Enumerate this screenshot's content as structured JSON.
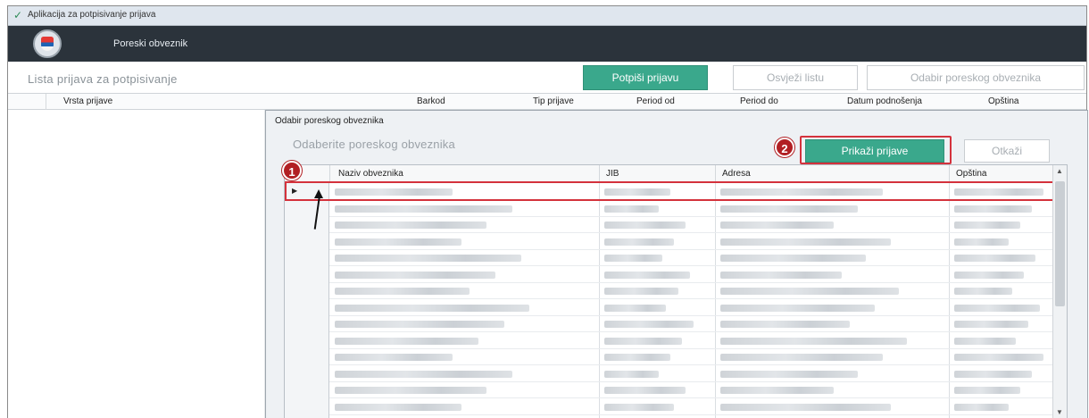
{
  "window": {
    "title": "Aplikacija za potpisivanje prijava"
  },
  "header": {
    "title": "Poreski obveznik"
  },
  "toolbar": {
    "list_title": "Lista prijava za potpisivanje",
    "sign_button": "Potpiši prijavu",
    "refresh_button": "Osvježi listu",
    "select_taxpayer_button": "Odabir poreskog obveznika"
  },
  "grid": {
    "columns": [
      "Vrsta prijave",
      "Barkod",
      "Tip prijave",
      "Period od",
      "Period do",
      "Datum podnošenja",
      "Opština"
    ]
  },
  "dialog": {
    "title": "Odabir poreskog obveznika",
    "subtitle": "Odaberite poreskog obveznika",
    "show_button": "Prikaži prijave",
    "cancel_button": "Otkaži",
    "columns": [
      "Naziv obveznika",
      "JIB",
      "Adresa",
      "Opština"
    ],
    "row_count": 14,
    "markers": [
      "1",
      "2"
    ]
  },
  "colors": {
    "accent": "#3aa88c",
    "highlight": "#d4323c",
    "marker": "#b11f23",
    "header_bg": "#2b333b"
  }
}
